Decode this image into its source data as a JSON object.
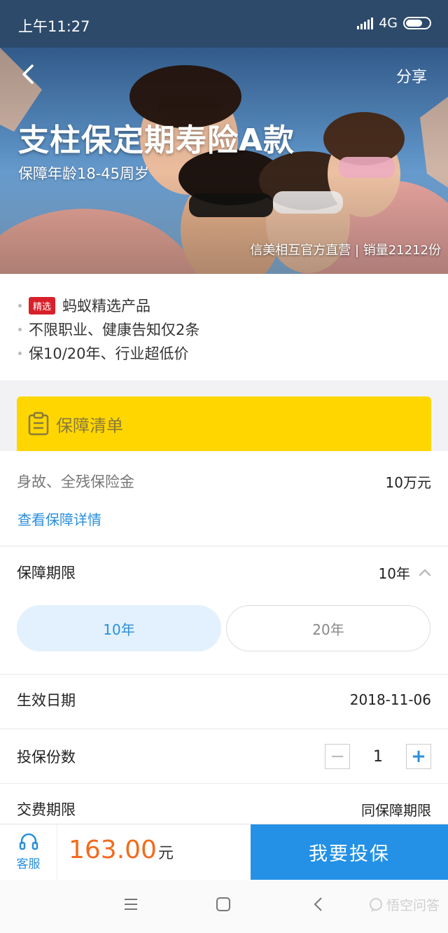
{
  "status_bar": {
    "time": "上午11:27",
    "network": "4G"
  },
  "hero": {
    "share_label": "分享",
    "title": "支柱保定期寿险A款",
    "subtitle": "保障年龄18-45周岁",
    "seller_info": "信美相互官方直营 | 销量21212份"
  },
  "features": {
    "tag": "精选",
    "items": [
      "蚂蚁精选产品",
      "不限职业、健康告知仅2条",
      "保10/20年、行业超低价"
    ]
  },
  "coverage": {
    "banner_label": "保障清单",
    "benefit_label": "身故、全残保险金",
    "benefit_value": "10万元",
    "details_link": "查看保障详情"
  },
  "term": {
    "label": "保障期限",
    "selected": "10年",
    "options": [
      "10年",
      "20年"
    ]
  },
  "effective_date": {
    "label": "生效日期",
    "value": "2018-11-06"
  },
  "quantity": {
    "label": "投保份数",
    "value": "1",
    "minus": "−",
    "plus": "+"
  },
  "payment_period": {
    "label": "交费期限",
    "value": "同保障期限"
  },
  "bottom_bar": {
    "service_label": "客服",
    "price": "163.00",
    "price_unit": "元",
    "buy_label": "我要投保"
  },
  "watermark": "悟空问答",
  "colors": {
    "accent": "#2491e6",
    "price": "#f26b1d",
    "banner": "#ffd600",
    "tag": "#d8202a"
  }
}
